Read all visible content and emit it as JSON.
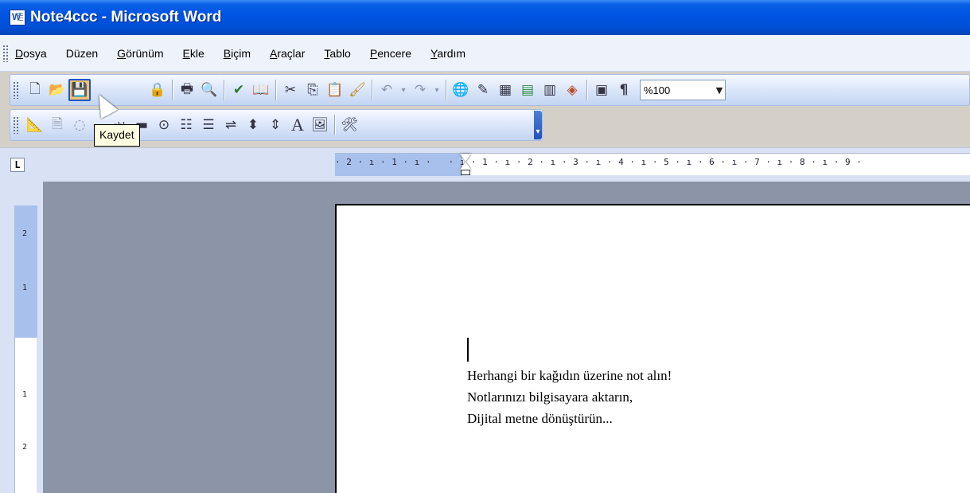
{
  "window": {
    "title": "Note4ccc - Microsoft Word"
  },
  "menu": [
    {
      "label": "Dosya",
      "u": "D",
      "rest": "osya"
    },
    {
      "label": "Düzen",
      "u": "",
      "rest": "Düzen"
    },
    {
      "label": "Görünüm",
      "u": "G",
      "rest": "örünüm"
    },
    {
      "label": "Ekle",
      "u": "E",
      "rest": "kle"
    },
    {
      "label": "Biçim",
      "u": "B",
      "rest": "içim"
    },
    {
      "label": "Araçlar",
      "u": "A",
      "rest": "raçlar"
    },
    {
      "label": "Tablo",
      "u": "T",
      "rest": "ablo"
    },
    {
      "label": "Pencere",
      "u": "P",
      "rest": "encere"
    },
    {
      "label": "Yardım",
      "u": "Y",
      "rest": "ardım"
    }
  ],
  "toolbar": {
    "zoom": "%100"
  },
  "tooltip": "Kaydet",
  "ruler": {
    "h_labels": "· 2 · ı · 1 · ı ·   · ı · 1 · ı · 2 · ı · 3 · ı · 4 · ı · 5 · ı · 6 · ı · 7 · ı · 8 · ı · 9 ·"
  },
  "document": {
    "lines": [
      "Herhangi bir kağıdın üzerine not alın!",
      "Notlarınızı bilgisayara aktarın,",
      "Dijital metne dönüştürün..."
    ]
  }
}
